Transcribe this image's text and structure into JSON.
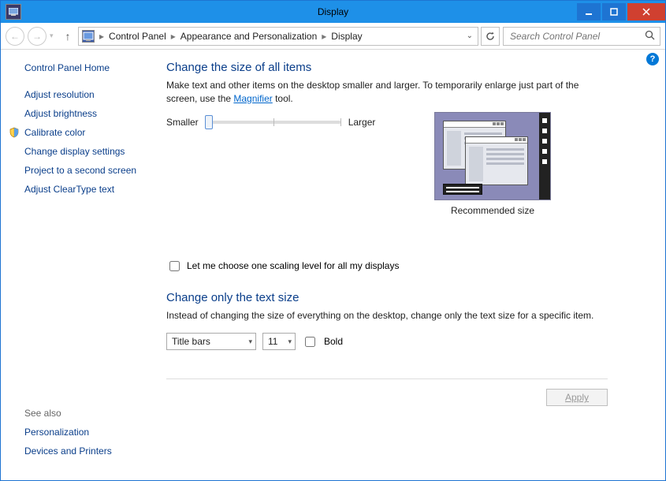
{
  "window": {
    "title": "Display"
  },
  "breadcrumb": {
    "parts": [
      "Control Panel",
      "Appearance and Personalization",
      "Display"
    ]
  },
  "search": {
    "placeholder": "Search Control Panel"
  },
  "sidebar": {
    "home": "Control Panel Home",
    "links": [
      "Adjust resolution",
      "Adjust brightness",
      "Calibrate color",
      "Change display settings",
      "Project to a second screen",
      "Adjust ClearType text"
    ],
    "see_also_label": "See also",
    "see_also": [
      "Personalization",
      "Devices and Printers"
    ]
  },
  "main": {
    "section1_title": "Change the size of all items",
    "section1_desc_a": "Make text and other items on the desktop smaller and larger. To temporarily enlarge just part of the screen, use the ",
    "section1_link": "Magnifier",
    "section1_desc_b": " tool.",
    "slider_min": "Smaller",
    "slider_max": "Larger",
    "preview_caption": "Recommended size",
    "checkbox_label": "Let me choose one scaling level for all my displays",
    "section2_title": "Change only the text size",
    "section2_desc": "Instead of changing the size of everything on the desktop, change only the text size for a specific item.",
    "text_item_select": "Title bars",
    "text_size_select": "11",
    "bold_label": "Bold",
    "apply_label": "Apply"
  }
}
